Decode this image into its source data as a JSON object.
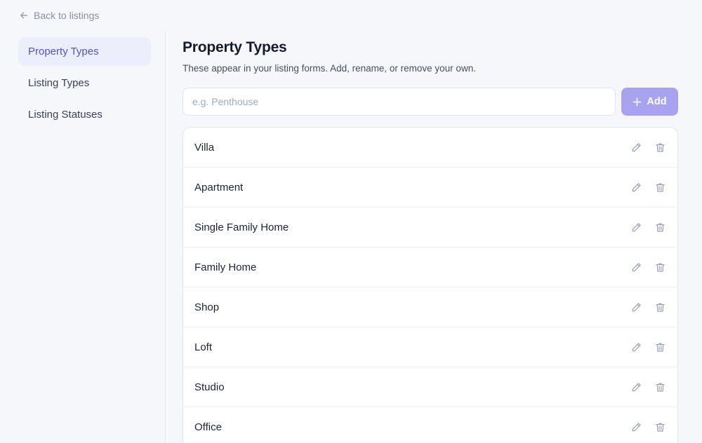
{
  "back_link": {
    "label": "Back to listings",
    "icon": "arrow-left-icon"
  },
  "sidebar": {
    "items": [
      {
        "label": "Property Types",
        "active": true
      },
      {
        "label": "Listing Types",
        "active": false
      },
      {
        "label": "Listing Statuses",
        "active": false
      }
    ]
  },
  "main": {
    "title": "Property Types",
    "subtitle": "These appear in your listing forms. Add, rename, or remove your own.",
    "add_input": {
      "placeholder": "e.g. Penthouse",
      "value": ""
    },
    "add_button": {
      "label": "Add",
      "icon": "plus-icon"
    },
    "items": [
      {
        "label": "Villa"
      },
      {
        "label": "Apartment"
      },
      {
        "label": "Single Family Home"
      },
      {
        "label": "Family Home"
      },
      {
        "label": "Shop"
      },
      {
        "label": "Loft"
      },
      {
        "label": "Studio"
      },
      {
        "label": "Office"
      }
    ],
    "row_actions": {
      "edit_icon": "pencil-icon",
      "delete_icon": "trash-icon"
    }
  },
  "colors": {
    "accent": "#5a4fcf",
    "accent_light": "#eceefb",
    "button_disabled": "#a9a3ef",
    "background": "#f6f7fb",
    "icon_muted": "#9b9fb0"
  }
}
